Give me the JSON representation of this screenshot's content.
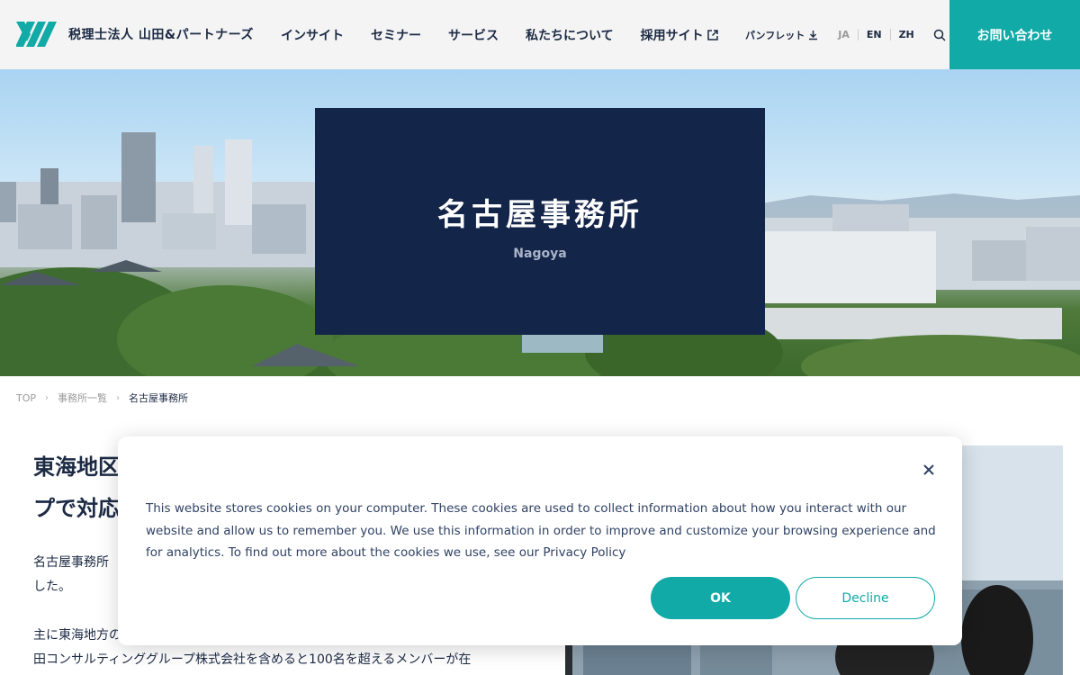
{
  "header": {
    "logo_text": "税理士法人 山田&パートナーズ",
    "nav": [
      "インサイト",
      "セミナー",
      "サービス",
      "私たちについて",
      "採用サイト"
    ],
    "pamphlet_label": "パンフレット",
    "languages": [
      "JA",
      "EN",
      "ZH"
    ],
    "contact_label": "お問い合わせ"
  },
  "hero": {
    "title": "名古屋事務所",
    "subtitle": "Nagoya"
  },
  "breadcrumb": [
    "TOP",
    "事務所一覧",
    "名古屋事務所"
  ],
  "main": {
    "heading_line1": "東海地区",
    "heading_line2": "プで対応",
    "para1_line1": "名古屋事務所",
    "para1_line2": "した。",
    "para2_line1": "主に東海地方の",
    "para2_line2": "田コンサルティンググループ株式会社を含めると100名を超えるメンバーが在"
  },
  "cookie": {
    "text": "This website stores cookies on your computer. These cookies are used to collect information about how you interact with our website and allow us to remember you. We use this information in order to improve and customize your browsing experience and for analytics. To find out more about the cookies we use, see our",
    "policy_link": "Privacy Policy",
    "ok_label": "OK",
    "decline_label": "Decline"
  },
  "colors": {
    "accent": "#11aaa6",
    "navy": "#14254a",
    "text": "#1c2a44"
  }
}
